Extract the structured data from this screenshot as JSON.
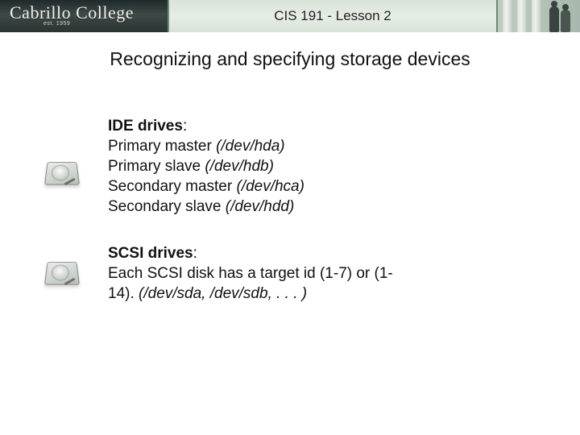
{
  "header": {
    "college_name": "Cabrillo College",
    "est": "est. 1959",
    "title": "CIS 191 - Lesson 2"
  },
  "heading": "Recognizing and specifying storage devices",
  "ide": {
    "title": "IDE drives",
    "rows": [
      {
        "label": "Primary master ",
        "dev": "(/dev/hda)"
      },
      {
        "label": "Primary slave ",
        "dev": "(/dev/hdb)"
      },
      {
        "label": "Secondary master ",
        "dev": "(/dev/hca)"
      },
      {
        "label": "Secondary slave ",
        "dev": "(/dev/hdd)"
      }
    ]
  },
  "scsi": {
    "title": "SCSI drives",
    "line_a": "Each SCSI disk has a target id (1-7) or (1-",
    "line_b_prefix": "14). ",
    "devs": "(/dev/sda, /dev/sdb, . . . )"
  }
}
